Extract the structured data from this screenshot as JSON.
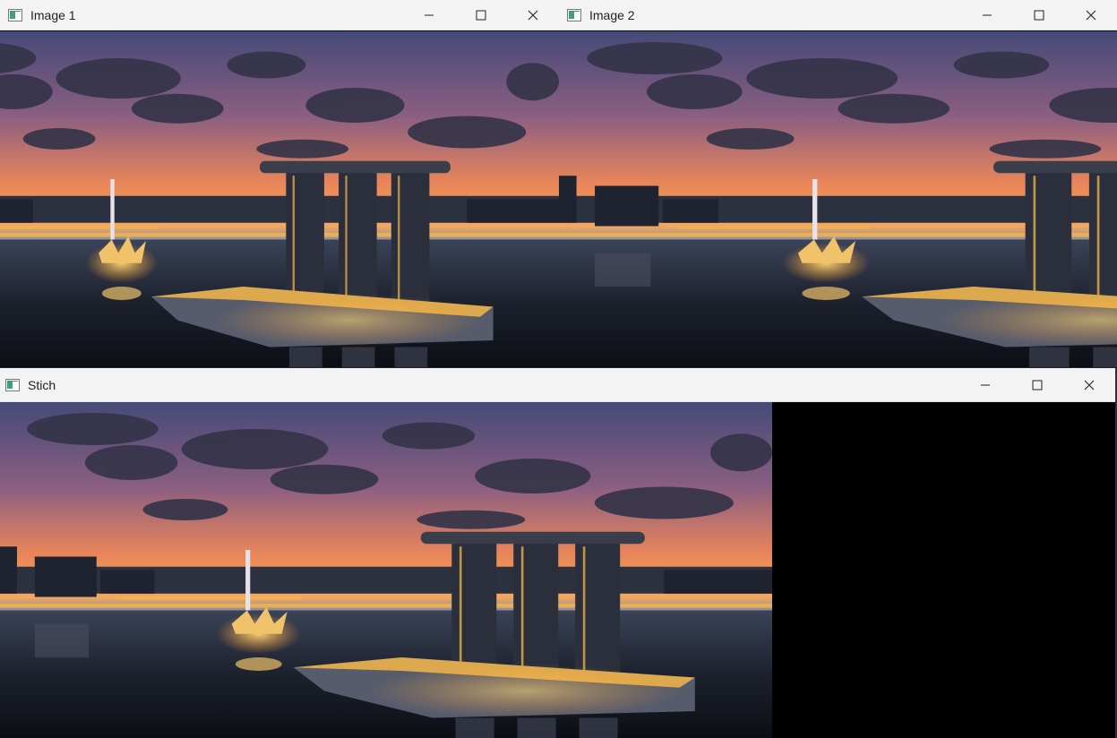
{
  "windows": {
    "image1": {
      "title": "Image 1"
    },
    "image2": {
      "title": "Image 2"
    },
    "stitch": {
      "title": "Stich"
    }
  },
  "controls": {
    "minimize_icon": "minimize-icon",
    "maximize_icon": "maximize-icon",
    "close_icon": "close-icon"
  },
  "colors": {
    "titlebar": "#f3f3f3",
    "black_fill": "#000000",
    "sky_top": "#4b4f7a",
    "sky_glow": "#f0934e",
    "city_light": "#f7b23b"
  }
}
